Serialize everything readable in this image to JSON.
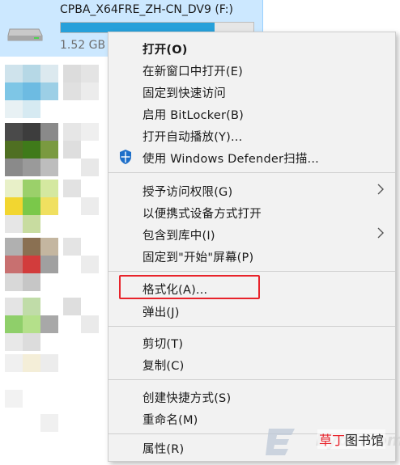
{
  "drive": {
    "name": "CPBA_X64FRE_ZH-CN_DV9 (F:)",
    "free_space": "1.52 GB",
    "usage_fraction": 0.8
  },
  "context_menu": {
    "items": [
      {
        "label": "打开(O)",
        "bold": true
      },
      {
        "label": "在新窗口中打开(E)"
      },
      {
        "label": "固定到快速访问"
      },
      {
        "label": "启用 BitLocker(B)"
      },
      {
        "label": "打开自动播放(Y)..."
      },
      {
        "label": "使用 Windows Defender扫描...",
        "icon": "windows-defender-shield-icon"
      },
      {
        "label": "授予访问权限(G)",
        "submenu": true
      },
      {
        "label": "以便携式设备方式打开"
      },
      {
        "label": "包含到库中(I)",
        "submenu": true
      },
      {
        "label": "固定到\"开始\"屏幕(P)"
      },
      {
        "label": "格式化(A)...",
        "highlighted": true
      },
      {
        "label": "弹出(J)"
      },
      {
        "label": "剪切(T)"
      },
      {
        "label": "复制(C)"
      },
      {
        "label": "创建快捷方式(S)"
      },
      {
        "label": "重命名(M)"
      },
      {
        "label": "属性(R)"
      }
    ]
  },
  "watermark": {
    "latin_text": "Eyou.com",
    "cn_text_accent": "草丁",
    "cn_text_rest": "图书馆"
  },
  "colors": {
    "selection_bg": "#cce8ff",
    "menu_bg": "#f2f2f2",
    "highlight_border": "#e8232b",
    "progress_fill": "#26a0da"
  }
}
